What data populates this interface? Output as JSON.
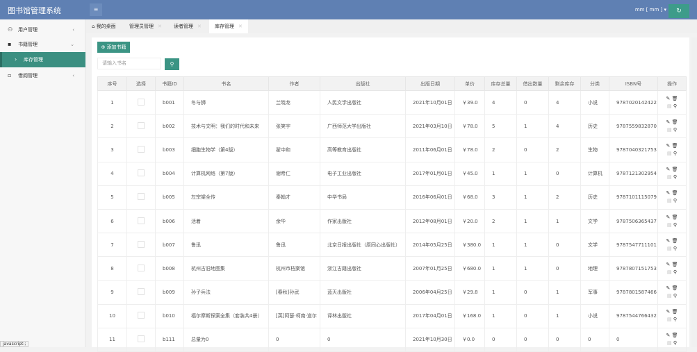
{
  "app": {
    "title": "图书馆管理系统",
    "user": "mm [ mm ]",
    "menu_icon": "≡",
    "refresh_icon": "↻"
  },
  "sidebar": {
    "items": [
      {
        "label": "用户管理",
        "icon": "user-icon",
        "chev": "‹"
      },
      {
        "label": "书籍管理",
        "icon": "book-icon",
        "chev": "⌄"
      },
      {
        "label": "库存管理",
        "chev": "›"
      },
      {
        "label": "借阅管理",
        "icon": "borrow-icon",
        "chev": "‹"
      }
    ]
  },
  "tabs": [
    {
      "label": "我的桌面",
      "icon": "home-icon"
    },
    {
      "label": "管理员管理"
    },
    {
      "label": "读者管理"
    },
    {
      "label": "库存管理"
    }
  ],
  "toolbar": {
    "add_label": "添加书籍",
    "search_placeholder": "请输入书名"
  },
  "colors": {
    "header": "#5f80b3",
    "accent": "#3b9484"
  },
  "table": {
    "headers": [
      "序号",
      "选择",
      "书籍ID",
      "书名",
      "作者",
      "出版社",
      "出版日期",
      "单价",
      "库存总量",
      "借出数量",
      "剩余库存",
      "分类",
      "ISBN号",
      "操作"
    ],
    "rows": [
      [
        "1",
        "b001",
        "冬与狮",
        "兰晓龙",
        "人民文学出版社",
        "2021年10月01日",
        "￥39.0",
        "4",
        "0",
        "4",
        "小说",
        "9787020142422"
      ],
      [
        "2",
        "b002",
        "技术与文明：我们的时代和未来",
        "张笑宇",
        "广西师范大学出版社",
        "2021年03月10日",
        "￥78.0",
        "5",
        "1",
        "4",
        "历史",
        "9787559832870"
      ],
      [
        "3",
        "b003",
        "细胞生物学（第4版）",
        "翟中和",
        "高等教育出版社",
        "2011年06月01日",
        "￥78.0",
        "2",
        "0",
        "2",
        "生物",
        "9787040321753"
      ],
      [
        "4",
        "b004",
        "计算机网络（第7版）",
        "谢希仁",
        "电子工业出版社",
        "2017年01月01日",
        "￥45.0",
        "1",
        "1",
        "0",
        "计算机",
        "9787121302954"
      ],
      [
        "5",
        "b005",
        "左宗棠全传",
        "秦翰才",
        "中华书局",
        "2016年06月01日",
        "￥68.0",
        "3",
        "1",
        "2",
        "历史",
        "9787101115079"
      ],
      [
        "6",
        "b006",
        "活着",
        "余华",
        "作家出版社",
        "2012年08月01日",
        "￥20.0",
        "2",
        "1",
        "1",
        "文学",
        "9787506365437"
      ],
      [
        "7",
        "b007",
        "鲁迅",
        "鲁迅",
        "北京日报出版社（原同心出版社）",
        "2014年05月25日",
        "￥380.0",
        "1",
        "1",
        "0",
        "文学",
        "9787547711101"
      ],
      [
        "8",
        "b008",
        "杭州古旧地图集",
        "杭州市档案馆",
        "浙江古籍出版社",
        "2007年01月25日",
        "￥680.0",
        "1",
        "1",
        "0",
        "地理",
        "9787807151753"
      ],
      [
        "9",
        "b009",
        "孙子兵法",
        "[春秋]孙武",
        "蓝天出版社",
        "2006年04月25日",
        "￥29.8",
        "1",
        "0",
        "1",
        "军事",
        "9787801587466"
      ],
      [
        "10",
        "b010",
        "福尔摩斯探案全集（套装共4册）",
        "[英]阿瑟·柯南·道尔",
        "译林出版社",
        "2017年04月01日",
        "￥168.0",
        "1",
        "0",
        "1",
        "小说",
        "9787544766432"
      ],
      [
        "11",
        "b111",
        "总量为0",
        "0",
        "0",
        "2021年10月30日",
        "￥0.0",
        "0",
        "0",
        "0",
        "0",
        "0"
      ]
    ]
  },
  "status": "javascript:;"
}
